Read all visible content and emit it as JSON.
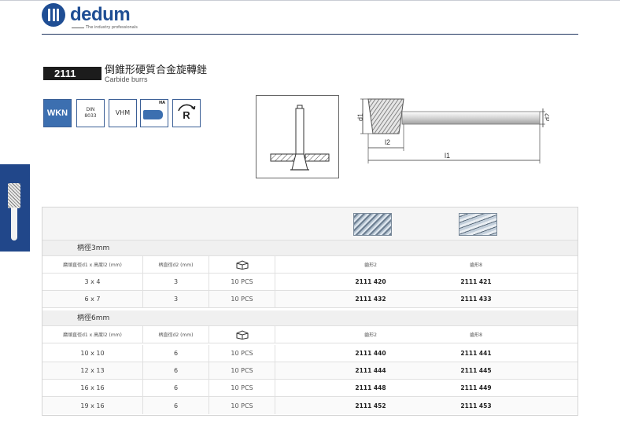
{
  "brand": {
    "name": "dedum",
    "tagline": "The industry professionals",
    "color": "#1f4e94"
  },
  "product": {
    "code": "2111",
    "title_cn": "倒錐形硬質合金旋轉銼",
    "title_en": "Carbide burrs"
  },
  "spec_icons": {
    "wkn": "WKN",
    "din_line1": "DIN",
    "din_line2": "8033",
    "vhm": "VHM",
    "ha": "HA",
    "rotation": "R"
  },
  "drawing_labels": {
    "d1": "d1",
    "d2": "d2",
    "l1": "l1",
    "l2": "l2"
  },
  "table": {
    "cut_type_images": [
      "burr-cut-2-image",
      "burr-cut-8-image"
    ],
    "groups": [
      {
        "title": "柄徑3mm",
        "headers": {
          "size": "磨頭直徑d1 x 高度l2 (mm)",
          "shank": "柄直徑d2 (mm)",
          "pack": "package-icon",
          "cut_a": "齒形2",
          "cut_b": "齒形8"
        },
        "rows": [
          {
            "size": "3 x 4",
            "shank": "3",
            "pack": "10 PCS",
            "cut_a": "2111 420",
            "cut_b": "2111 421"
          },
          {
            "size": "6 x 7",
            "shank": "3",
            "pack": "10 PCS",
            "cut_a": "2111 432",
            "cut_b": "2111 433"
          }
        ]
      },
      {
        "title": "柄徑6mm",
        "headers": {
          "size": "磨頭直徑d1 x 高度l2 (mm)",
          "shank": "柄直徑d2 (mm)",
          "pack": "package-icon",
          "cut_a": "齒形2",
          "cut_b": "齒形8"
        },
        "rows": [
          {
            "size": "10 x 10",
            "shank": "6",
            "pack": "10 PCS",
            "cut_a": "2111 440",
            "cut_b": "2111 441"
          },
          {
            "size": "12 x 13",
            "shank": "6",
            "pack": "10 PCS",
            "cut_a": "2111 444",
            "cut_b": "2111 445"
          },
          {
            "size": "16 x 16",
            "shank": "6",
            "pack": "10 PCS",
            "cut_a": "2111 448",
            "cut_b": "2111 449"
          },
          {
            "size": "19 x 16",
            "shank": "6",
            "pack": "10 PCS",
            "cut_a": "2111 452",
            "cut_b": "2111 453"
          }
        ]
      }
    ]
  }
}
